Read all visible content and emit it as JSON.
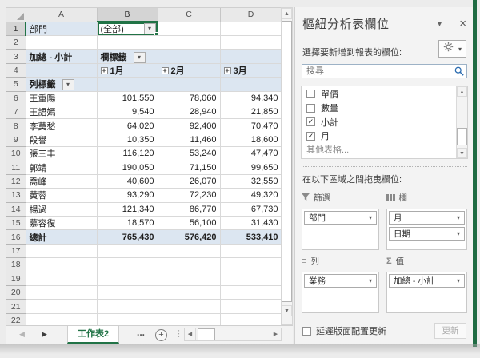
{
  "icons": {
    "dropdown": "▾",
    "close": "×",
    "pane_chevron": "▾",
    "up": "▲",
    "down": "▼",
    "left": "◀",
    "right": "▶",
    "prev": "◀",
    "next": "▶",
    "plus": "+",
    "ellipsis_v": "⋮",
    "rows": "≡",
    "sigma": "Σ",
    "check": "✓",
    "expand": "+"
  },
  "grid": {
    "columns": [
      "A",
      "B",
      "C",
      "D"
    ],
    "rows": [
      {
        "n": 1,
        "c": [
          {
            "v": "部門",
            "k": "band"
          },
          {
            "v": "(全部)",
            "k": "filter sel dd"
          },
          null,
          null
        ]
      },
      {
        "n": 2,
        "c": [
          null,
          null,
          null,
          null
        ]
      },
      {
        "n": 3,
        "c": [
          {
            "v": "加總 - 小計",
            "k": "band bold"
          },
          {
            "v": "欄標籤",
            "k": "band bold dd"
          },
          {
            "k": "band"
          },
          {
            "k": "band"
          }
        ]
      },
      {
        "n": 4,
        "c": [
          {
            "k": "band"
          },
          {
            "v": "1月",
            "k": "band bold exp"
          },
          {
            "v": "2月",
            "k": "band bold exp"
          },
          {
            "v": "3月",
            "k": "band bold exp"
          }
        ]
      },
      {
        "n": 5,
        "c": [
          {
            "v": "列標籤",
            "k": "band bold dd"
          },
          {
            "k": "band"
          },
          {
            "k": "band"
          },
          {
            "k": "band"
          }
        ]
      },
      {
        "n": 6,
        "c": [
          {
            "v": "王重陽"
          },
          {
            "v": "101,550",
            "k": "num"
          },
          {
            "v": "78,060",
            "k": "num"
          },
          {
            "v": "94,340",
            "k": "num"
          }
        ]
      },
      {
        "n": 7,
        "c": [
          {
            "v": "王語嫣"
          },
          {
            "v": "9,540",
            "k": "num"
          },
          {
            "v": "28,940",
            "k": "num"
          },
          {
            "v": "21,850",
            "k": "num"
          }
        ]
      },
      {
        "n": 8,
        "c": [
          {
            "v": "李莫愁"
          },
          {
            "v": "64,020",
            "k": "num"
          },
          {
            "v": "92,400",
            "k": "num"
          },
          {
            "v": "70,470",
            "k": "num"
          }
        ]
      },
      {
        "n": 9,
        "c": [
          {
            "v": "段譽"
          },
          {
            "v": "10,350",
            "k": "num"
          },
          {
            "v": "11,460",
            "k": "num"
          },
          {
            "v": "18,600",
            "k": "num"
          }
        ]
      },
      {
        "n": 10,
        "c": [
          {
            "v": "張三丰"
          },
          {
            "v": "116,120",
            "k": "num"
          },
          {
            "v": "53,240",
            "k": "num"
          },
          {
            "v": "47,470",
            "k": "num"
          }
        ]
      },
      {
        "n": 11,
        "c": [
          {
            "v": "郭靖"
          },
          {
            "v": "190,050",
            "k": "num"
          },
          {
            "v": "71,150",
            "k": "num"
          },
          {
            "v": "99,650",
            "k": "num"
          }
        ]
      },
      {
        "n": 12,
        "c": [
          {
            "v": "喬峰"
          },
          {
            "v": "40,600",
            "k": "num"
          },
          {
            "v": "26,070",
            "k": "num"
          },
          {
            "v": "32,550",
            "k": "num"
          }
        ]
      },
      {
        "n": 13,
        "c": [
          {
            "v": "黃蓉"
          },
          {
            "v": "93,290",
            "k": "num"
          },
          {
            "v": "72,230",
            "k": "num"
          },
          {
            "v": "49,320",
            "k": "num"
          }
        ]
      },
      {
        "n": 14,
        "c": [
          {
            "v": "楊過"
          },
          {
            "v": "121,340",
            "k": "num"
          },
          {
            "v": "86,770",
            "k": "num"
          },
          {
            "v": "67,730",
            "k": "num"
          }
        ]
      },
      {
        "n": 15,
        "c": [
          {
            "v": "慕容復"
          },
          {
            "v": "18,570",
            "k": "num"
          },
          {
            "v": "56,100",
            "k": "num"
          },
          {
            "v": "31,430",
            "k": "num"
          }
        ]
      },
      {
        "n": 16,
        "c": [
          {
            "v": "總計",
            "k": "band bold"
          },
          {
            "v": "765,430",
            "k": "band bold num"
          },
          {
            "v": "576,420",
            "k": "band bold num"
          },
          {
            "v": "533,410",
            "k": "band bold num"
          }
        ]
      },
      {
        "n": 17,
        "c": [
          null,
          null,
          null,
          null
        ]
      },
      {
        "n": 18,
        "c": [
          null,
          null,
          null,
          null
        ]
      },
      {
        "n": 19,
        "c": [
          null,
          null,
          null,
          null
        ]
      },
      {
        "n": 20,
        "c": [
          null,
          null,
          null,
          null
        ]
      },
      {
        "n": 21,
        "c": [
          null,
          null,
          null,
          null
        ]
      },
      {
        "n": 22,
        "c": [
          null,
          null,
          null,
          null
        ]
      }
    ]
  },
  "tabbar": {
    "active_tab": "工作表2",
    "more_tabs": "..."
  },
  "panel": {
    "title": "樞紐分析表欄位",
    "subtitle": "選擇要新增到報表的欄位:",
    "search_placeholder": "搜尋",
    "fields": [
      {
        "label": "單價",
        "checked": false
      },
      {
        "label": "數量",
        "checked": false
      },
      {
        "label": "小計",
        "checked": true
      },
      {
        "label": "月",
        "checked": true
      }
    ],
    "more_tables": "其他表格...",
    "drag_hint": "在以下區域之間拖曳欄位:",
    "areas": {
      "filters": {
        "label": "篩選",
        "items": [
          "部門"
        ]
      },
      "columns": {
        "label": "欄",
        "items": [
          "月",
          "日期"
        ]
      },
      "rows": {
        "label": "列",
        "items": [
          "業務"
        ]
      },
      "values": {
        "label": "值",
        "items": [
          "加總 - 小計"
        ]
      }
    },
    "defer_label": "延遲版面配置更新",
    "update_label": "更新"
  }
}
